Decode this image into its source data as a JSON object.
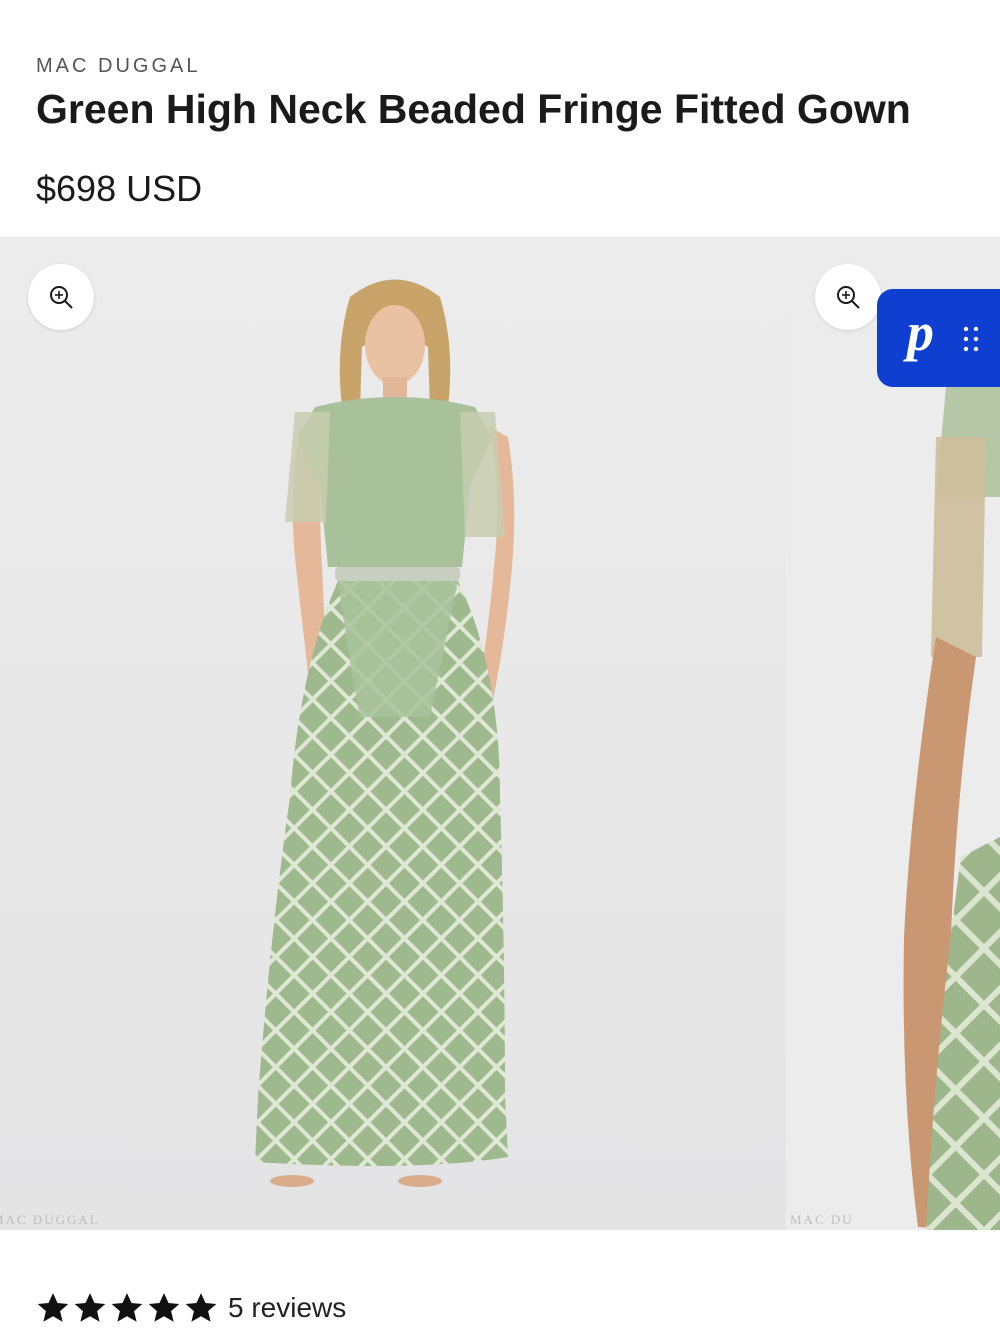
{
  "product": {
    "vendor": "MAC DUGGAL",
    "title": "Green High Neck Beaded Fringe Fitted Gown",
    "price": "$698 USD"
  },
  "gallery": {
    "watermark": "MAC DUGGAL",
    "watermark_partial": "MAC DU",
    "zoom_icon": "zoom-in-icon",
    "dress_color": "#9fb98f",
    "background_color": "#e9e9ea"
  },
  "widget": {
    "letter": "p",
    "brand_color": "#0e3fd0"
  },
  "reviews": {
    "rating": 5,
    "max_rating": 5,
    "count_label": "5 reviews"
  }
}
